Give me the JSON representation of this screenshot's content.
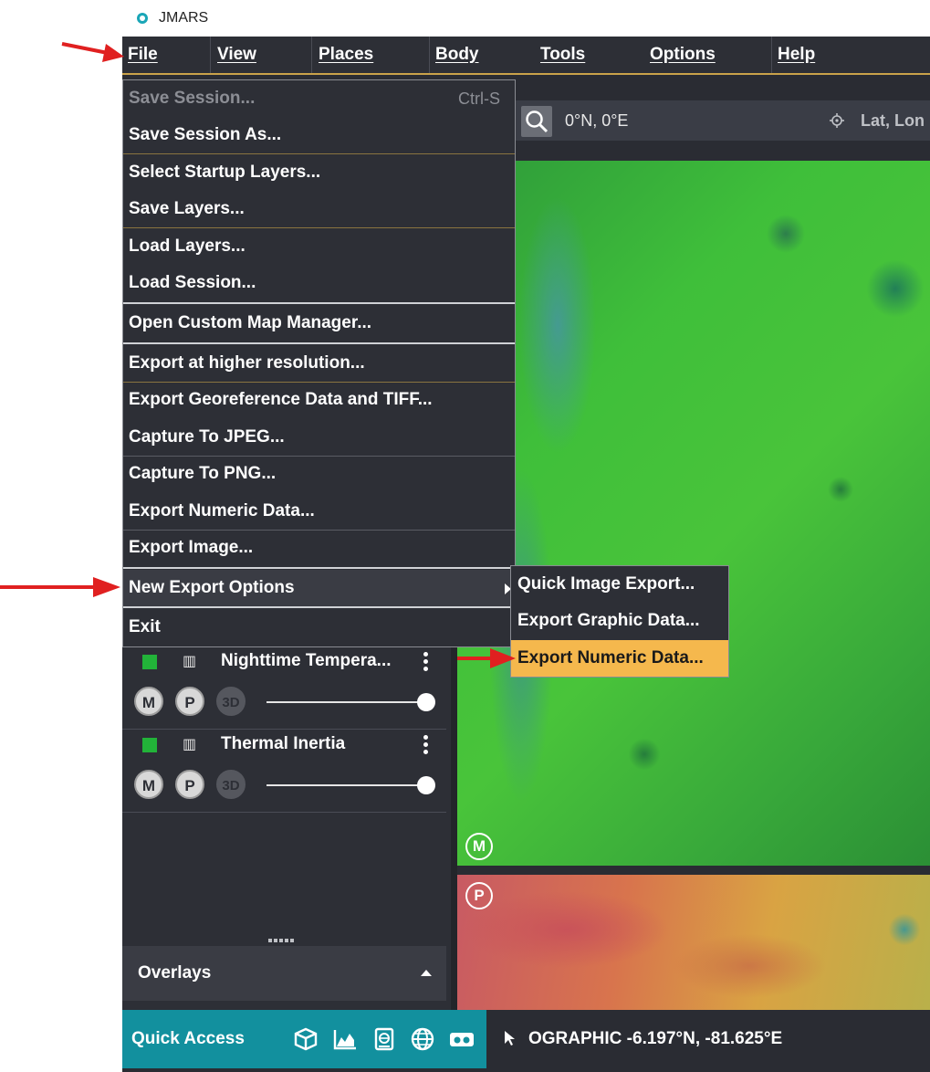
{
  "window": {
    "title": "JMARS"
  },
  "menubar": {
    "items": [
      {
        "label": "File"
      },
      {
        "label": "View"
      },
      {
        "label": "Places"
      },
      {
        "label": "Body"
      },
      {
        "label": "Tools"
      },
      {
        "label": "Options"
      },
      {
        "label": "Help"
      }
    ]
  },
  "search": {
    "value": "0°N, 0°E",
    "mode_label": "Lat, Lon"
  },
  "file_menu": {
    "items": [
      {
        "label": "Save Session...",
        "shortcut": "Ctrl-S",
        "enabled": false
      },
      {
        "label": "Save Session As..."
      },
      {
        "label": "Select Startup Layers..."
      },
      {
        "label": "Save Layers..."
      },
      {
        "label": "Load Layers..."
      },
      {
        "label": "Load Session..."
      },
      {
        "label": "Open Custom Map Manager..."
      },
      {
        "label": "Export at higher resolution..."
      },
      {
        "label": "Export Georeference Data and TIFF..."
      },
      {
        "label": "Capture To JPEG..."
      },
      {
        "label": "Capture To PNG..."
      },
      {
        "label": "Export Numeric Data..."
      },
      {
        "label": "Export Image..."
      },
      {
        "label": "New Export Options",
        "has_submenu": true
      },
      {
        "label": "Exit"
      }
    ]
  },
  "export_submenu": {
    "items": [
      {
        "label": "Quick Image Export..."
      },
      {
        "label": "Export Graphic Data..."
      },
      {
        "label": "Export Numeric Data...",
        "highlighted": true
      }
    ]
  },
  "layers": [
    {
      "name": "Nighttime Tempera...",
      "buttons": [
        "M",
        "P",
        "3D"
      ],
      "opacity": 1.0
    },
    {
      "name": "Thermal Inertia",
      "buttons": [
        "M",
        "P",
        "3D"
      ],
      "opacity": 1.0
    }
  ],
  "overlays": {
    "title": "Overlays"
  },
  "map_markers": {
    "main": "M",
    "panner": "P"
  },
  "quick_access": {
    "label": "Quick Access",
    "icons": [
      "cube-icon",
      "chart-icon",
      "doc-globe-icon",
      "globe-icon",
      "vr-headset-icon"
    ]
  },
  "status": {
    "readout": "OGRAPHIC  -6.197°N, -81.625°E"
  },
  "colors": {
    "accent": "#12909e",
    "highlight": "#f5b84d",
    "menu_bg": "#2d2f36",
    "annotation": "#e02020"
  }
}
